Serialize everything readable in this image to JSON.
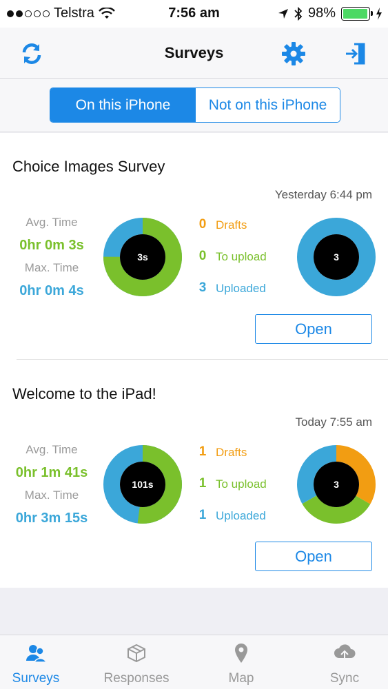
{
  "status_bar": {
    "carrier": "Telstra",
    "time": "7:56 am",
    "battery": "98%",
    "battery_level": 0.98
  },
  "nav": {
    "title": "Surveys",
    "left_icon": "refresh-icon",
    "right_icons": [
      "gear-icon",
      "logout-icon"
    ]
  },
  "segment": {
    "options": [
      "On this iPhone",
      "Not on this iPhone"
    ],
    "selected": "On this iPhone"
  },
  "labels": {
    "avg_time": "Avg. Time",
    "max_time": "Max. Time",
    "drafts": "Drafts",
    "to_upload": "To upload",
    "uploaded": "Uploaded",
    "open": "Open"
  },
  "surveys": [
    {
      "title": "Choice Images Survey",
      "date": "Yesterday 6:44 pm",
      "avg_time": "0hr 0m 3s",
      "max_time": "0hr 0m 4s",
      "time_center": "3s",
      "time_ring_fraction_avg": 0.75,
      "drafts": "0",
      "to_upload": "0",
      "uploaded": "3",
      "count_center": "3"
    },
    {
      "title": "Welcome to the iPad!",
      "date": "Today 7:55 am",
      "avg_time": "0hr 1m 41s",
      "max_time": "0hr 3m 15s",
      "time_center": "101s",
      "time_ring_fraction_avg": 0.52,
      "drafts": "1",
      "to_upload": "1",
      "uploaded": "1",
      "count_center": "3"
    }
  ],
  "tabs": [
    {
      "label": "Surveys",
      "icon": "people-icon",
      "active": true
    },
    {
      "label": "Responses",
      "icon": "box-icon",
      "active": false
    },
    {
      "label": "Map",
      "icon": "map-pin-icon",
      "active": false
    },
    {
      "label": "Sync",
      "icon": "cloud-sync-icon",
      "active": false
    }
  ],
  "colors": {
    "accent": "#1c88e6",
    "green": "#7ac02c",
    "blue": "#3ba7d9",
    "orange": "#f29d12"
  }
}
